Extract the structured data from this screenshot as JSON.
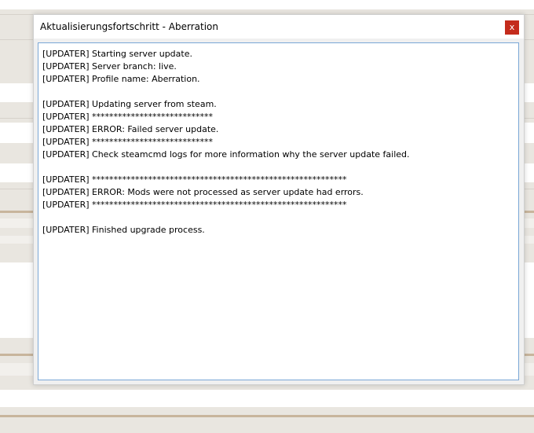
{
  "window": {
    "title": "Aktualisierungsfortschritt - Aberration",
    "close_label": "x"
  },
  "log": {
    "lines": [
      "[UPDATER] Starting server update.",
      "[UPDATER] Server branch: live.",
      "[UPDATER] Profile name: Aberration.",
      "",
      "[UPDATER] Updating server from steam.",
      "[UPDATER] ****************************",
      "[UPDATER] ERROR: Failed server update.",
      "[UPDATER] ****************************",
      "[UPDATER] Check steamcmd logs for more information why the server update failed.",
      "",
      "[UPDATER] ***********************************************************",
      "[UPDATER] ERROR: Mods were not processed as server update had errors.",
      "[UPDATER] ***********************************************************",
      "",
      "[UPDATER] Finished upgrade process."
    ]
  },
  "colors": {
    "close_button": "#c42b1c",
    "log_border": "#7aa7d6",
    "background": "#e9e6e0"
  }
}
